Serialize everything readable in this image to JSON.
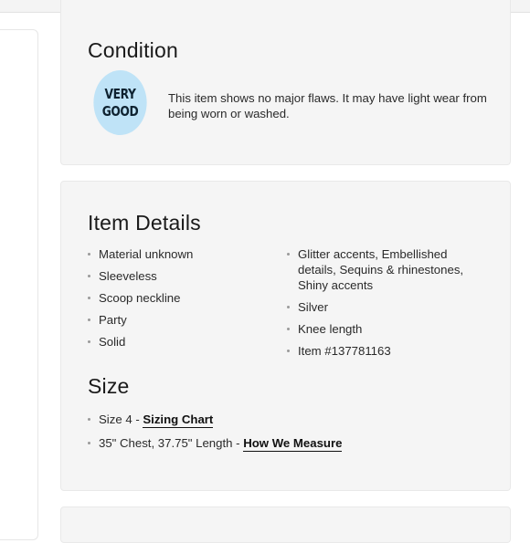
{
  "condition": {
    "title": "Condition",
    "badge_line1": "VERY",
    "badge_line2": "GOOD",
    "description": "This item shows no major flaws. It may have light wear from being worn or washed."
  },
  "item_details": {
    "title": "Item Details",
    "left": [
      "Material unknown",
      "Sleeveless",
      "Scoop neckline",
      "Party",
      "Solid"
    ],
    "right": [
      "Glitter accents, Embellished details, Sequins & rhinestones, Shiny accents",
      "Silver",
      "Knee length",
      "Item #137781163"
    ]
  },
  "size": {
    "title": "Size",
    "line1_text": "Size 4 - ",
    "line1_link": "Sizing Chart",
    "line2_text": "35\" Chest, 37.75\" Length - ",
    "line2_link": "How We Measure"
  },
  "colors": {
    "badge_bg": "#bfe3f7",
    "card_bg": "#f5f5f5"
  }
}
